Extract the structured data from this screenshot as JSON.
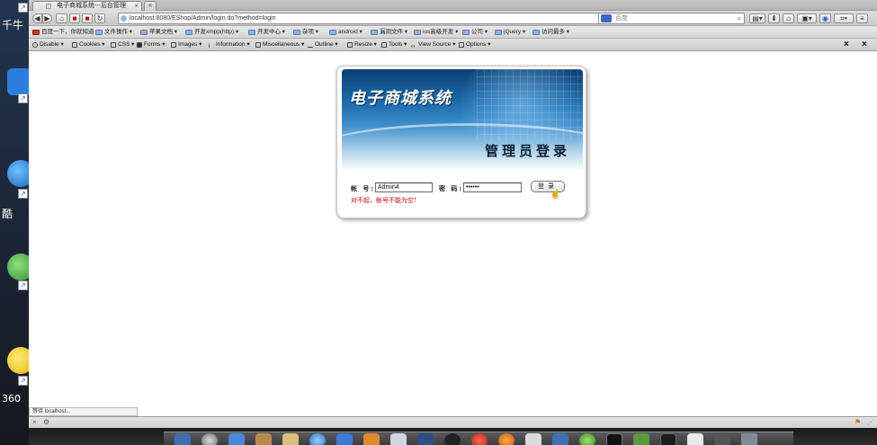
{
  "desktop": {
    "labels": [
      "千牛",
      "酷",
      "360"
    ]
  },
  "browser": {
    "tab": {
      "title": "电子商城系统---后台管理",
      "close": "×"
    },
    "new_tab": "+",
    "url": "localhost:8080/EShop/Admin/login.do?method=login",
    "search_placeholder": "百度",
    "bookmarks": [
      "百度一下，你就知道",
      "文件操作 ▾",
      "苹果文档 ▾",
      "开发xmpp(http) ▾",
      "开发中心 ▾",
      "杂项 ▾",
      "android ▾",
      "漏洞文件 ▾",
      "ios高级开发 ▾",
      "公司 ▾",
      "jQuery ▾",
      "访问最多 ▾"
    ],
    "devtools": [
      "Disable ▾",
      "Cookies ▾",
      "CSS ▾",
      "Forms ▾",
      "Images ▾",
      "Information ▾",
      "Miscellaneous ▾",
      "Outline ▾",
      "Resize ▾",
      "Tools ▾",
      "View Source ▾",
      "Options ▾"
    ],
    "status": "等待 localhost..."
  },
  "login": {
    "site_title": "电子商城系统",
    "admin_title": "管理员登录",
    "account_label": "帐 号:",
    "account_value": "Admin4",
    "password_label": "密 码:",
    "password_value": "••••••",
    "button_label": "登录",
    "error": "对不起，帐号不能为空!"
  },
  "colors": {
    "banner_dark": "#0b3f72",
    "banner_mid": "#3f8fcc",
    "error": "#d00000"
  }
}
